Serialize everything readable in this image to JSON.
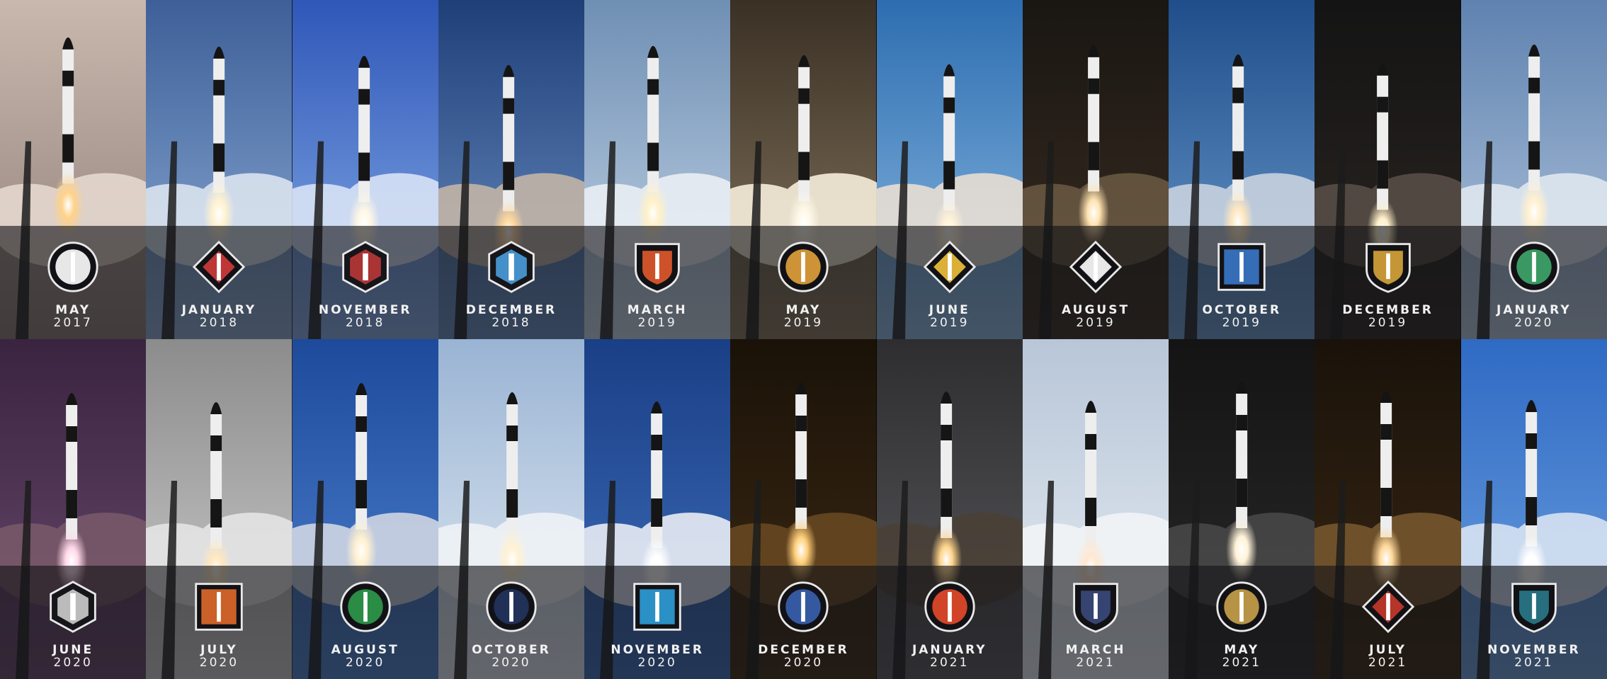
{
  "launches": [
    {
      "month": "MAY",
      "year": "2017",
      "sky": [
        "#c9b8ad",
        "#8e7d78"
      ],
      "cloud": "#e9dcd2",
      "flame": "#ffd28a",
      "patch": "ring",
      "patch_color": "#ffffff"
    },
    {
      "month": "JANUARY",
      "year": "2018",
      "sky": [
        "#3e5f98",
        "#8fb0d8"
      ],
      "cloud": "#e2e9f2",
      "flame": "#fff3d0",
      "patch": "diamond-flag",
      "patch_color": "#d33b3b"
    },
    {
      "month": "NOVEMBER",
      "year": "2018",
      "sky": [
        "#2f57b8",
        "#8ab0e8"
      ],
      "cloud": "#dfe8f8",
      "flame": "#fff7e6",
      "patch": "hex",
      "patch_color": "#c43a3a"
    },
    {
      "month": "DECEMBER",
      "year": "2018",
      "sky": [
        "#1f3f78",
        "#6d92c6"
      ],
      "cloud": "#c9b9a7",
      "flame": "#ffd8a0",
      "patch": "hex-blue",
      "patch_color": "#4ea6e8"
    },
    {
      "month": "MARCH",
      "year": "2019",
      "sky": [
        "#6f8fb4",
        "#c8d8e8"
      ],
      "cloud": "#eef2f6",
      "flame": "#fff1c8",
      "patch": "shield",
      "patch_color": "#e25a2c"
    },
    {
      "month": "MAY",
      "year": "2019",
      "sky": [
        "#3a3024",
        "#8a7a62"
      ],
      "cloud": "#fff6e4",
      "flame": "#fff8e8",
      "patch": "circle-dark",
      "patch_color": "#e2a23a"
    },
    {
      "month": "JUNE",
      "year": "2019",
      "sky": [
        "#2d6db0",
        "#8fbde4"
      ],
      "cloud": "#f0e2d4",
      "flame": "#fff2d8",
      "patch": "diamond-rainbow",
      "patch_color": "#f2c23a"
    },
    {
      "month": "AUGUST",
      "year": "2019",
      "sky": [
        "#1a1612",
        "#3a2e22"
      ],
      "cloud": "#6b5a44",
      "flame": "#ffe2b0",
      "patch": "diamond-8",
      "patch_color": "#ffffff"
    },
    {
      "month": "OCTOBER",
      "year": "2019",
      "sky": [
        "#1f4e8a",
        "#6f9ed0"
      ],
      "cloud": "#cfd7e2",
      "flame": "#ffe8c0",
      "patch": "square-blue",
      "patch_color": "#3a78c8"
    },
    {
      "month": "DECEMBER",
      "year": "2019",
      "sky": [
        "#141414",
        "#2c2622"
      ],
      "cloud": "#5a5048",
      "flame": "#fff0c8",
      "patch": "shield-gold",
      "patch_color": "#d9a53a"
    },
    {
      "month": "JANUARY",
      "year": "2020",
      "sky": [
        "#5f82b0",
        "#b8cbe0"
      ],
      "cloud": "#e4ebf2",
      "flame": "#fff0d0",
      "patch": "circle-green",
      "patch_color": "#3fa86a"
    },
    {
      "month": "JUNE",
      "year": "2020",
      "sky": [
        "#3a2440",
        "#6a4a6e"
      ],
      "cloud": "#7a5a6a",
      "flame": "#ffd8e8",
      "patch": "hex-grey",
      "patch_color": "#d8d8d8"
    },
    {
      "month": "JULY",
      "year": "2020",
      "sky": [
        "#8c8c8c",
        "#cfcfcf"
      ],
      "cloud": "#e8e8e8",
      "flame": "#ffe8c0",
      "patch": "square-orange",
      "patch_color": "#e06a2a"
    },
    {
      "month": "AUGUST",
      "year": "2020",
      "sky": [
        "#1e4a9c",
        "#4f84d0"
      ],
      "cloud": "#d8dce6",
      "flame": "#fff0d0",
      "patch": "circle-white",
      "patch_color": "#2f9a4a"
    },
    {
      "month": "OCTOBER",
      "year": "2020",
      "sky": [
        "#9ab4d4",
        "#e4ecf4"
      ],
      "cloud": "#f2f5f8",
      "flame": "#fff2d4",
      "patch": "circle-navy",
      "patch_color": "#22345e"
    },
    {
      "month": "NOVEMBER",
      "year": "2020",
      "sky": [
        "#1a3f86",
        "#3f6fbc"
      ],
      "cloud": "#f4f6fa",
      "flame": "#ffffff",
      "patch": "stamp",
      "patch_color": "#2f9fd8"
    },
    {
      "month": "DECEMBER",
      "year": "2020",
      "sky": [
        "#1a1208",
        "#3e2a14"
      ],
      "cloud": "#6a4a22",
      "flame": "#ffcf7a",
      "patch": "circle-blue",
      "patch_color": "#3a62b0"
    },
    {
      "month": "JANUARY",
      "year": "2021",
      "sky": [
        "#2e2e30",
        "#5a5a5e"
      ],
      "cloud": "#4a4036",
      "flame": "#ffd48a",
      "patch": "circle-flag",
      "patch_color": "#e84a2a"
    },
    {
      "month": "MARCH",
      "year": "2021",
      "sky": [
        "#b8c6d8",
        "#e8eef4"
      ],
      "cloud": "#f4f6f8",
      "flame": "#ffe8d0",
      "patch": "shield-navy",
      "patch_color": "#3a4a7a"
    },
    {
      "month": "MAY",
      "year": "2021",
      "sky": [
        "#141414",
        "#2a2a2a"
      ],
      "cloud": "#4a4a4a",
      "flame": "#fff2d8",
      "patch": "circle-gold",
      "patch_color": "#c9a24a"
    },
    {
      "month": "JULY",
      "year": "2021",
      "sky": [
        "#1a120a",
        "#3a2814"
      ],
      "cloud": "#7a5a30",
      "flame": "#ffd89a",
      "patch": "diamond-red",
      "patch_color": "#c83a2a"
    },
    {
      "month": "NOVEMBER",
      "year": "2021",
      "sky": [
        "#2f6ac4",
        "#6fa2e0"
      ],
      "cloud": "#dfe8f4",
      "flame": "#ffffff",
      "patch": "shield-teal",
      "patch_color": "#2a7a8a"
    }
  ]
}
